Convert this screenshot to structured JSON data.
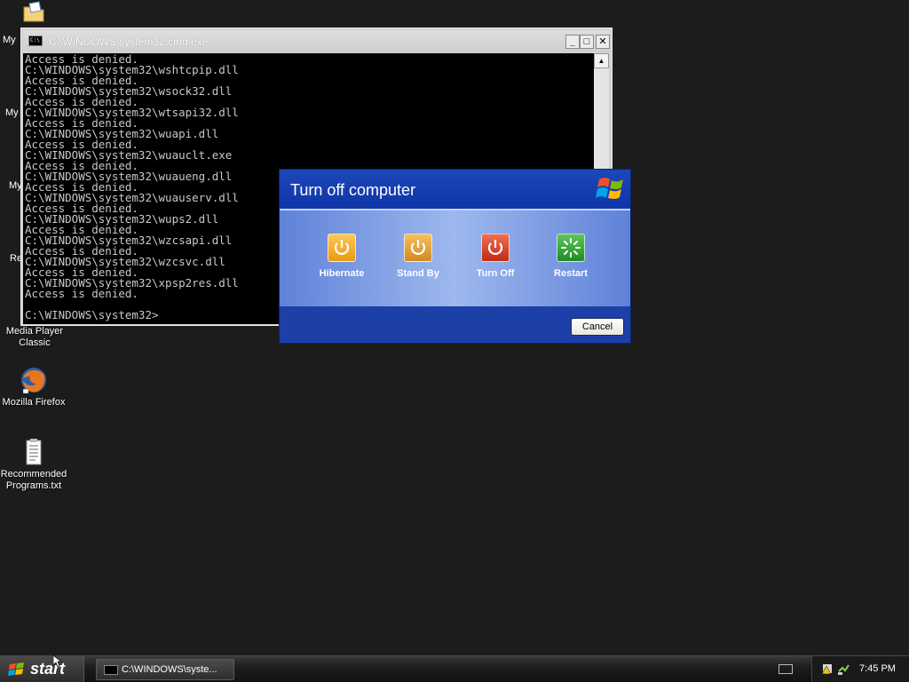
{
  "desktop": {
    "partial_labels": [
      "My",
      "My",
      "My",
      "Re"
    ],
    "icons": [
      {
        "label": "Media Player Classic"
      },
      {
        "label": "Mozilla Firefox"
      },
      {
        "label": "Recommended Programs.txt"
      }
    ]
  },
  "cmd": {
    "title": "C:\\WINDOWS\\system32\\cmd.exe",
    "lines": [
      "Access is denied.",
      "C:\\WINDOWS\\system32\\wshtcpip.dll",
      "Access is denied.",
      "C:\\WINDOWS\\system32\\wsock32.dll",
      "Access is denied.",
      "C:\\WINDOWS\\system32\\wtsapi32.dll",
      "Access is denied.",
      "C:\\WINDOWS\\system32\\wuapi.dll",
      "Access is denied.",
      "C:\\WINDOWS\\system32\\wuauclt.exe",
      "Access is denied.",
      "C:\\WINDOWS\\system32\\wuaueng.dll",
      "Access is denied.",
      "C:\\WINDOWS\\system32\\wuauserv.dll",
      "Access is denied.",
      "C:\\WINDOWS\\system32\\wups2.dll",
      "Access is denied.",
      "C:\\WINDOWS\\system32\\wzcsapi.dll",
      "Access is denied.",
      "C:\\WINDOWS\\system32\\wzcsvc.dll",
      "Access is denied.",
      "C:\\WINDOWS\\system32\\xpsp2res.dll",
      "Access is denied.",
      "",
      "C:\\WINDOWS\\system32>"
    ]
  },
  "dialog": {
    "title": "Turn off computer",
    "options": [
      {
        "label": "Hibernate",
        "color": "#f0a020"
      },
      {
        "label": "Stand By",
        "color": "#e8a030"
      },
      {
        "label": "Turn Off",
        "color": "#d83a24"
      },
      {
        "label": "Restart",
        "color": "#3aa43a"
      }
    ],
    "cancel_label": "Cancel"
  },
  "taskbar": {
    "start_label": "start",
    "task_label": "C:\\WINDOWS\\syste...",
    "clock": "7:45 PM"
  }
}
